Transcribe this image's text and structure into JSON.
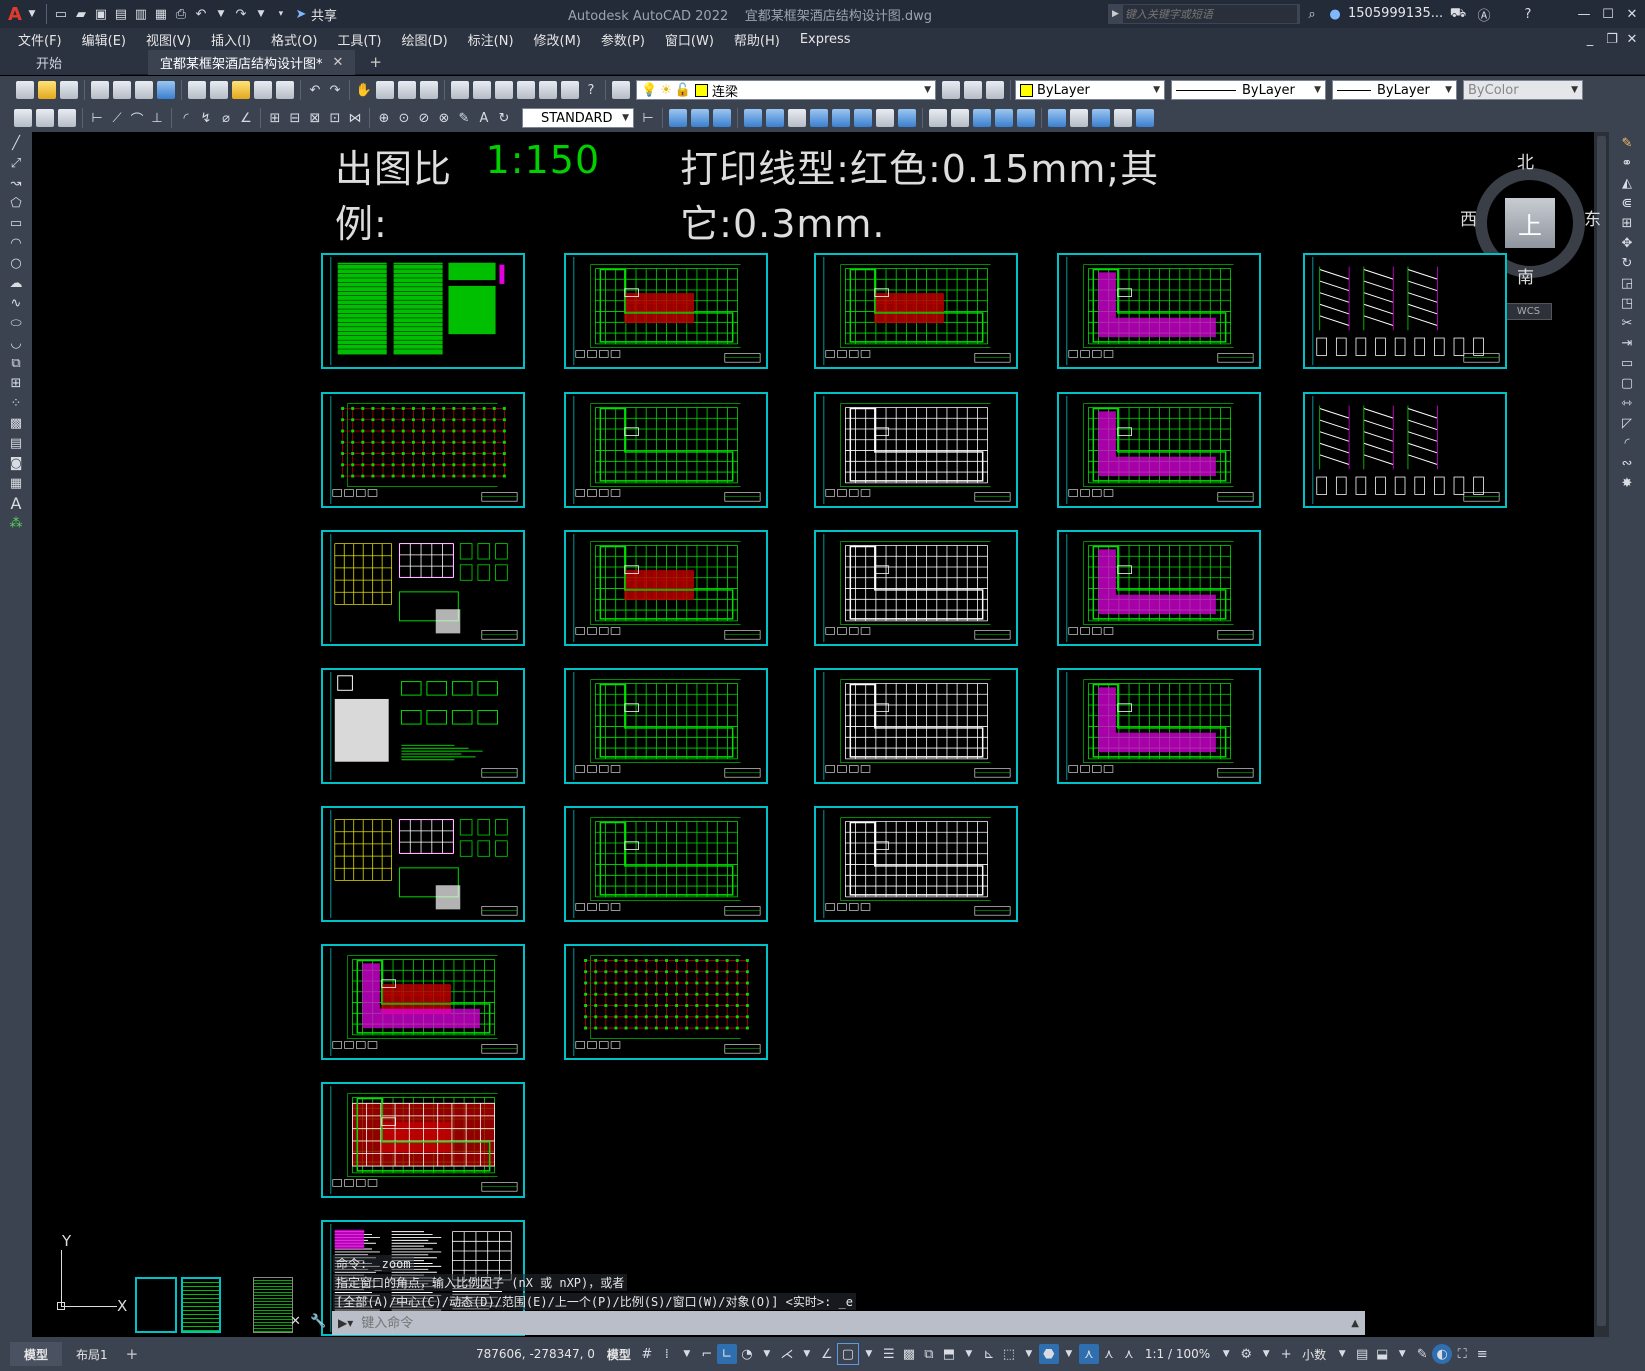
{
  "app": {
    "name": "Autodesk AutoCAD 2022",
    "file": "宜都某框架酒店结构设计图.dwg"
  },
  "titlebar": {
    "share_label": "共享",
    "search_placeholder": "键入关键字或短语",
    "user": "1505999135...",
    "logo": "A"
  },
  "menu": [
    "文件(F)",
    "编辑(E)",
    "视图(V)",
    "插入(I)",
    "格式(O)",
    "工具(T)",
    "绘图(D)",
    "标注(N)",
    "修改(M)",
    "参数(P)",
    "窗口(W)",
    "帮助(H)",
    "Express"
  ],
  "tabs": {
    "start": "开始",
    "doc": "宜都某框架酒店结构设计图*",
    "add": "+"
  },
  "toolbar": {
    "layer": "连梁",
    "color": "ByLayer",
    "linetype": "ByLayer",
    "lineweight": "ByLayer",
    "plotstyle": "ByColor",
    "textstyle": "STANDARD"
  },
  "drawing": {
    "scale_label": "出图比例:",
    "scale_value": "1:150",
    "print_note": "打印线型:红色:0.15mm;其它:0.3mm."
  },
  "viewcube": {
    "n": "北",
    "s": "南",
    "e": "东",
    "w": "西",
    "top": "上",
    "wcs": "WCS"
  },
  "ucs": {
    "x": "X",
    "y": "Y"
  },
  "command": {
    "line1": "命令: _zoom",
    "line2": "指定窗口的角点，输入比例因子 (nX 或 nXP)，或者",
    "line3": "[全部(A)/中心(C)/动态(D)/范围(E)/上一个(P)/比例(S)/窗口(W)/对象(O)] <实时>: _e",
    "placeholder": "键入命令"
  },
  "layout_tabs": {
    "model": "模型",
    "layout1": "布局1",
    "add": "+"
  },
  "status": {
    "coords": "787606, -278347, 0",
    "model": "模型",
    "scale": "1:1 / 100%",
    "units": "小数"
  },
  "colors": {
    "cyan": "#00c0c8",
    "green": "#00e000",
    "red": "#c00000",
    "magenta": "#e000e0",
    "white": "#ffffff",
    "yellow": "#e0e000"
  }
}
